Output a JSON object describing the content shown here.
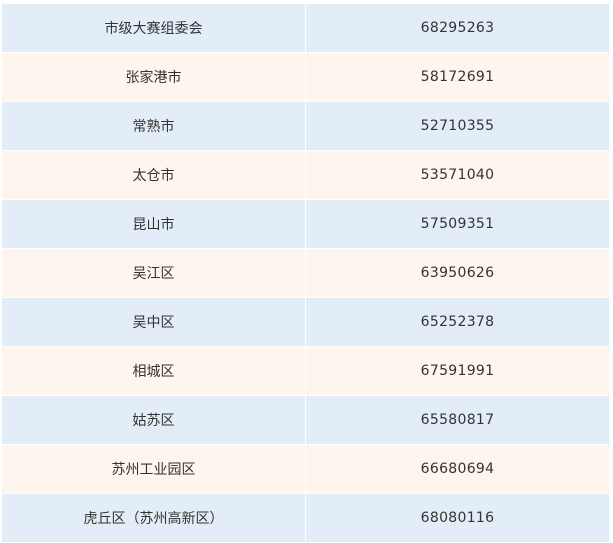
{
  "rows": [
    {
      "name": "市级大赛组委会",
      "phone": "68295263",
      "shade": "blue"
    },
    {
      "name": "张家港市",
      "phone": "58172691",
      "shade": "cream"
    },
    {
      "name": "常熟市",
      "phone": "52710355",
      "shade": "blue"
    },
    {
      "name": "太仓市",
      "phone": "53571040",
      "shade": "cream"
    },
    {
      "name": "昆山市",
      "phone": "57509351",
      "shade": "blue"
    },
    {
      "name": "吴江区",
      "phone": "63950626",
      "shade": "cream"
    },
    {
      "name": "吴中区",
      "phone": "65252378",
      "shade": "blue"
    },
    {
      "name": "相城区",
      "phone": "67591991",
      "shade": "cream"
    },
    {
      "name": "姑苏区",
      "phone": "65580817",
      "shade": "blue"
    },
    {
      "name": "苏州工业园区",
      "phone": "66680694",
      "shade": "cream"
    },
    {
      "name": "虎丘区（苏州高新区）",
      "phone": "68080116",
      "shade": "blue"
    }
  ],
  "colors": {
    "row_blue": "#e3edf7",
    "row_cream": "#fdf5ee",
    "text": "#333333"
  }
}
